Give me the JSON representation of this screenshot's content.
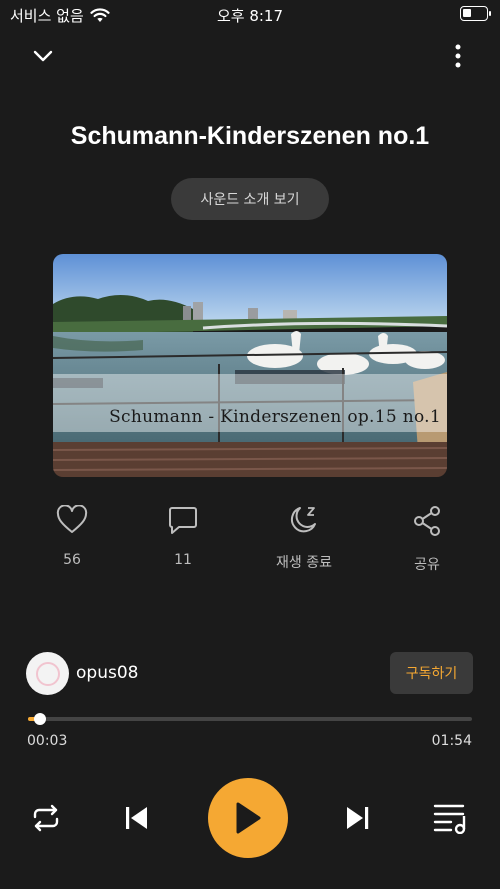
{
  "status": {
    "carrier": "서비스 없음",
    "time": "오후 8:17",
    "icons": [
      "wifi-icon",
      "battery-icon"
    ]
  },
  "header": {
    "collapse_icon": "chevron-down-icon",
    "more_icon": "more-vertical-icon"
  },
  "track": {
    "title": "Schumann-Kinderszenen no.1",
    "intro_button": "사운드 소개 보기",
    "cover_caption": "Schumann - Kinderszenen op.15 no.1"
  },
  "actions": [
    {
      "icon": "heart-icon",
      "label": "56"
    },
    {
      "icon": "comment-icon",
      "label": "11"
    },
    {
      "icon": "moon-sleep-icon",
      "label": "재생 종료"
    },
    {
      "icon": "share-icon",
      "label": "공유"
    }
  ],
  "artist": {
    "name": "opus08",
    "subscribe_label": "구독하기"
  },
  "player": {
    "current_time": "00:03",
    "total_time": "01:54",
    "progress": 0.026,
    "controls": [
      "repeat-icon",
      "previous-icon",
      "play-icon",
      "next-icon",
      "playlist-icon"
    ]
  },
  "colors": {
    "accent": "#f5a833",
    "background": "#1b1b1b",
    "button_bg": "#3a3a3a"
  }
}
